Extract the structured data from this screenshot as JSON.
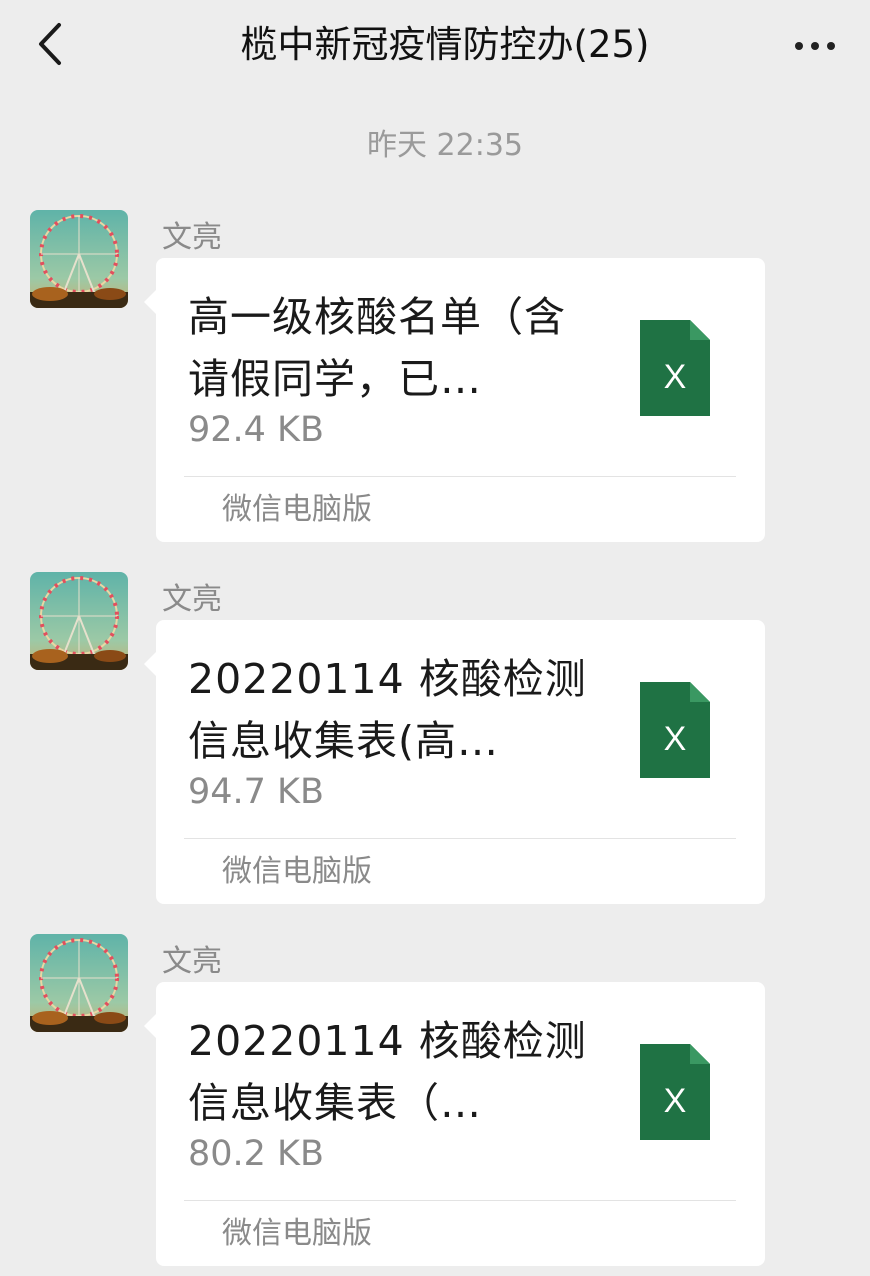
{
  "header": {
    "title": "榄中新冠疫情防控办(25)"
  },
  "icons": {
    "back": "chevron-left-icon",
    "more": "more-dots-icon",
    "file": "excel-file-icon"
  },
  "colors": {
    "background": "#ededed",
    "bubble": "#ffffff",
    "excel_green": "#1f7244"
  },
  "timestamp": "昨天 22:35",
  "messages": [
    {
      "sender": "文亮",
      "file_name": "高一级核酸名单（含\n请假同学，已…",
      "file_size": "92.4 KB",
      "file_icon_letter": "X",
      "source": "微信电脑版"
    },
    {
      "sender": "文亮",
      "file_name": "20220114 核酸检测\n信息收集表(高…",
      "file_size": "94.7 KB",
      "file_icon_letter": "X",
      "source": "微信电脑版"
    },
    {
      "sender": "文亮",
      "file_name": "20220114 核酸检测\n信息收集表（…",
      "file_size": "80.2 KB",
      "file_icon_letter": "X",
      "source": "微信电脑版"
    }
  ]
}
